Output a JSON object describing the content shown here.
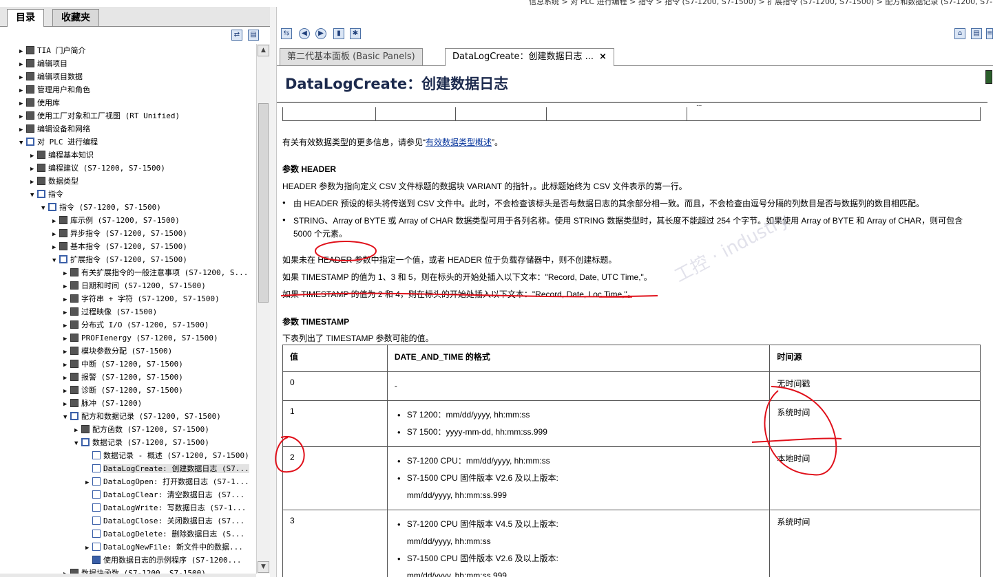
{
  "breadcrumb": "信息系统 > 对 PLC 进行编程 > 指令 > 指令 (S7-1200, S7-1500) > 扩展指令 (S7-1200, S7-1500) > 配方和数据记录 (S7-1200, S7-",
  "left_tabs": [
    "目录",
    "收藏夹"
  ],
  "tree": [
    {
      "label": "TIA 门户简介",
      "level": 0,
      "icon": "book",
      "tw": "▶"
    },
    {
      "label": "编辑项目",
      "level": 0,
      "icon": "book",
      "tw": "▶"
    },
    {
      "label": "编辑项目数据",
      "level": 0,
      "icon": "book",
      "tw": "▶"
    },
    {
      "label": "管理用户和角色",
      "level": 0,
      "icon": "book",
      "tw": "▶"
    },
    {
      "label": "使用库",
      "level": 0,
      "icon": "book",
      "tw": "▶"
    },
    {
      "label": "使用工厂对象和工厂视图 (RT Unified)",
      "level": 0,
      "icon": "book",
      "tw": "▶"
    },
    {
      "label": "编辑设备和网络",
      "level": 0,
      "icon": "book",
      "tw": "▶"
    },
    {
      "label": "对 PLC 进行编程",
      "level": 0,
      "icon": "bookopen",
      "tw": "▼"
    },
    {
      "label": "编程基本知识",
      "level": 1,
      "icon": "book",
      "tw": "▶"
    },
    {
      "label": "编程建议 (S7-1200, S7-1500)",
      "level": 1,
      "icon": "book",
      "tw": "▶"
    },
    {
      "label": "数据类型",
      "level": 1,
      "icon": "book",
      "tw": "▶"
    },
    {
      "label": "指令",
      "level": 1,
      "icon": "bookopen",
      "tw": "▼"
    },
    {
      "label": "指令 (S7-1200, S7-1500)",
      "level": 2,
      "icon": "bookopen",
      "tw": "▼"
    },
    {
      "label": "库示例 (S7-1200, S7-1500)",
      "level": 3,
      "icon": "book",
      "tw": "▶"
    },
    {
      "label": "异步指令 (S7-1200, S7-1500)",
      "level": 3,
      "icon": "book",
      "tw": "▶"
    },
    {
      "label": "基本指令 (S7-1200, S7-1500)",
      "level": 3,
      "icon": "book",
      "tw": "▶"
    },
    {
      "label": "扩展指令 (S7-1200, S7-1500)",
      "level": 3,
      "icon": "bookopen",
      "tw": "▼"
    },
    {
      "label": "有关扩展指令的一般注意事项 (S7-1200, S...",
      "level": 4,
      "icon": "book",
      "tw": "▶"
    },
    {
      "label": "日期和时间 (S7-1200, S7-1500)",
      "level": 4,
      "icon": "book",
      "tw": "▶"
    },
    {
      "label": "字符串 + 字符 (S7-1200, S7-1500)",
      "level": 4,
      "icon": "book",
      "tw": "▶"
    },
    {
      "label": "过程映像 (S7-1500)",
      "level": 4,
      "icon": "book",
      "tw": "▶"
    },
    {
      "label": "分布式 I/O (S7-1200, S7-1500)",
      "level": 4,
      "icon": "book",
      "tw": "▶"
    },
    {
      "label": "PROFIenergy (S7-1200, S7-1500)",
      "level": 4,
      "icon": "book",
      "tw": "▶"
    },
    {
      "label": "模块参数分配 (S7-1500)",
      "level": 4,
      "icon": "book",
      "tw": "▶"
    },
    {
      "label": "中断 (S7-1200, S7-1500)",
      "level": 4,
      "icon": "book",
      "tw": "▶"
    },
    {
      "label": "报警 (S7-1200, S7-1500)",
      "level": 4,
      "icon": "book",
      "tw": "▶"
    },
    {
      "label": "诊断 (S7-1200, S7-1500)",
      "level": 4,
      "icon": "book",
      "tw": "▶"
    },
    {
      "label": "脉冲 (S7-1200)",
      "level": 4,
      "icon": "book",
      "tw": "▶"
    },
    {
      "label": "配方和数据记录 (S7-1200, S7-1500)",
      "level": 4,
      "icon": "bookopen",
      "tw": "▼"
    },
    {
      "label": "配方函数 (S7-1200, S7-1500)",
      "level": 5,
      "icon": "book",
      "tw": "▶"
    },
    {
      "label": "数据记录 (S7-1200, S7-1500)",
      "level": 5,
      "icon": "bookopen",
      "tw": "▼"
    },
    {
      "label": "数据记录 - 概述 (S7-1200, S7-1500)",
      "level": 6,
      "icon": "page",
      "tw": ""
    },
    {
      "label": "DataLogCreate: 创建数据日志 (S7...",
      "level": 6,
      "icon": "page",
      "tw": "",
      "selected": true
    },
    {
      "label": "DataLogOpen: 打开数据日志 (S7-1...",
      "level": 6,
      "icon": "page",
      "tw": "▶"
    },
    {
      "label": "DataLogClear: 清空数据日志 (S7...",
      "level": 6,
      "icon": "page",
      "tw": ""
    },
    {
      "label": "DataLogWrite: 写数据日志 (S7-1...",
      "level": 6,
      "icon": "page",
      "tw": ""
    },
    {
      "label": "DataLogClose: 关闭数据日志 (S7...",
      "level": 6,
      "icon": "page",
      "tw": ""
    },
    {
      "label": "DataLogDelete: 删除数据日志 (S...",
      "level": 6,
      "icon": "page",
      "tw": ""
    },
    {
      "label": "DataLogNewFile: 新文件中的数据...",
      "level": 6,
      "icon": "page",
      "tw": "▶"
    },
    {
      "label": "使用数据日志的示例程序 (S7-1200...",
      "level": 6,
      "icon": "pagex",
      "tw": ""
    },
    {
      "label": "数据块函数 (S7-1200, S7-1500)",
      "level": 4,
      "icon": "book",
      "tw": "▶"
    }
  ],
  "right_tabs": {
    "inactive": "第二代基本面板 (Basic Panels)",
    "active": "DataLogCreate：创建数据日志 ...",
    "close": "×"
  },
  "page_title": "DataLogCreate：创建数据日志",
  "table_stub_text": "...",
  "content": {
    "see_more_prefix": "有关有效数据类型的更多信息，请参见“",
    "see_more_link": "有效数据类型概述",
    "see_more_suffix": "”。",
    "h_header": "参数 HEADER",
    "p_header": "HEADER 参数为指向定义 CSV 文件标题的数据块 VARIANT 的指针，。此标题始终为 CSV 文件表示的第一行。",
    "bullet1": "由 HEADER 预设的标头将传送到 CSV 文件中。此时，不会检查该标头是否与数据日志的其余部分相一致。而且，不会检查由逗号分隔的列数目是否与数据列的数目相匹配。",
    "bullet2_line1": "STRING、Array of BYTE 或 Array of CHAR 数据类型可用于各列名称。使用 STRING 数据类型时，其长度不能超过 254 个字节。如果使用 Array of BYTE 和 Array of CHAR，则可包含",
    "bullet2_line2": "5000 个元素。",
    "p_no_header": "如果未在 HEADER 参数中指定一个值，或者 HEADER 位于负载存储器中，则不创建标题。",
    "p_ts_135": "如果 TIMESTAMP 的值为 1、3 和 5，则在标头的开始处插入以下文本：\"Record, Date, UTC Time,\"。",
    "p_ts_24": "如果 TIMESTAMP 的值为 2 和 4，则在标头的开始处插入以下文本：\"Record, Date, Loc Time,\"。",
    "h_timestamp": "参数 TIMESTAMP",
    "p_timestamp": "下表列出了 TIMESTAMP 参数可能的值。"
  },
  "ts_table": {
    "headers": [
      "值",
      "DATE_AND_TIME 的格式",
      "时间源"
    ],
    "rows": [
      {
        "value": "0",
        "formats": [
          "-"
        ],
        "plain": true,
        "source": "无时间戳"
      },
      {
        "value": "1",
        "formats": [
          "S7 1200：mm/dd/yyyy, hh:mm:ss",
          "S7 1500：yyyy-mm-dd, hh:mm:ss.999"
        ],
        "source": "系统时间"
      },
      {
        "value": "2",
        "formats": [
          "S7-1200 CPU：mm/dd/yyyy, hh:mm:ss",
          "S7-1500 CPU 固件版本 V2.6 及以上版本:",
          "mm/dd/yyyy, hh:mm:ss.999"
        ],
        "source": "本地时间"
      },
      {
        "value": "3",
        "formats": [
          "S7-1200 CPU 固件版本 V4.5 及以上版本:",
          "mm/dd/yyyy, hh:mm:ss",
          "S7-1500 CPU 固件版本 V2.6 及以上版本:",
          "mm/dd/yyyy, hh:mm:ss.999"
        ],
        "source": "系统时间"
      }
    ]
  }
}
